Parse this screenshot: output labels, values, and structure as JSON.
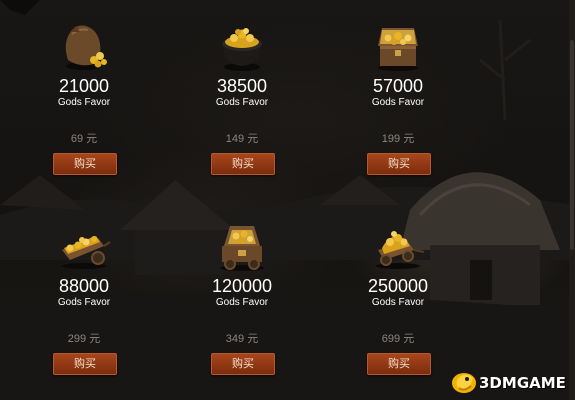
{
  "packs": [
    {
      "amount": "21000",
      "currency": "Gods Favor",
      "price": "69 元",
      "buy_label": "购买",
      "icon": "coin-sack-icon"
    },
    {
      "amount": "38500",
      "currency": "Gods Favor",
      "price": "149 元",
      "buy_label": "购买",
      "icon": "coin-pot-icon"
    },
    {
      "amount": "57000",
      "currency": "Gods Favor",
      "price": "199 元",
      "buy_label": "购买",
      "icon": "treasure-chest-icon"
    },
    {
      "amount": "88000",
      "currency": "Gods Favor",
      "price": "299 元",
      "buy_label": "购买",
      "icon": "coin-wheelbarrow-icon"
    },
    {
      "amount": "120000",
      "currency": "Gods Favor",
      "price": "349 元",
      "buy_label": "购买",
      "icon": "coin-cart-icon"
    },
    {
      "amount": "250000",
      "currency": "Gods Favor",
      "price": "699 元",
      "buy_label": "购买",
      "icon": "coin-wagon-icon"
    }
  ],
  "watermark": {
    "text": "3DMGAME"
  },
  "colors": {
    "button": "#8e3612",
    "button_border": "#b9582a",
    "amount_text": "#ffffff",
    "price_text": "#8a8580",
    "gold": "#e8b524"
  }
}
